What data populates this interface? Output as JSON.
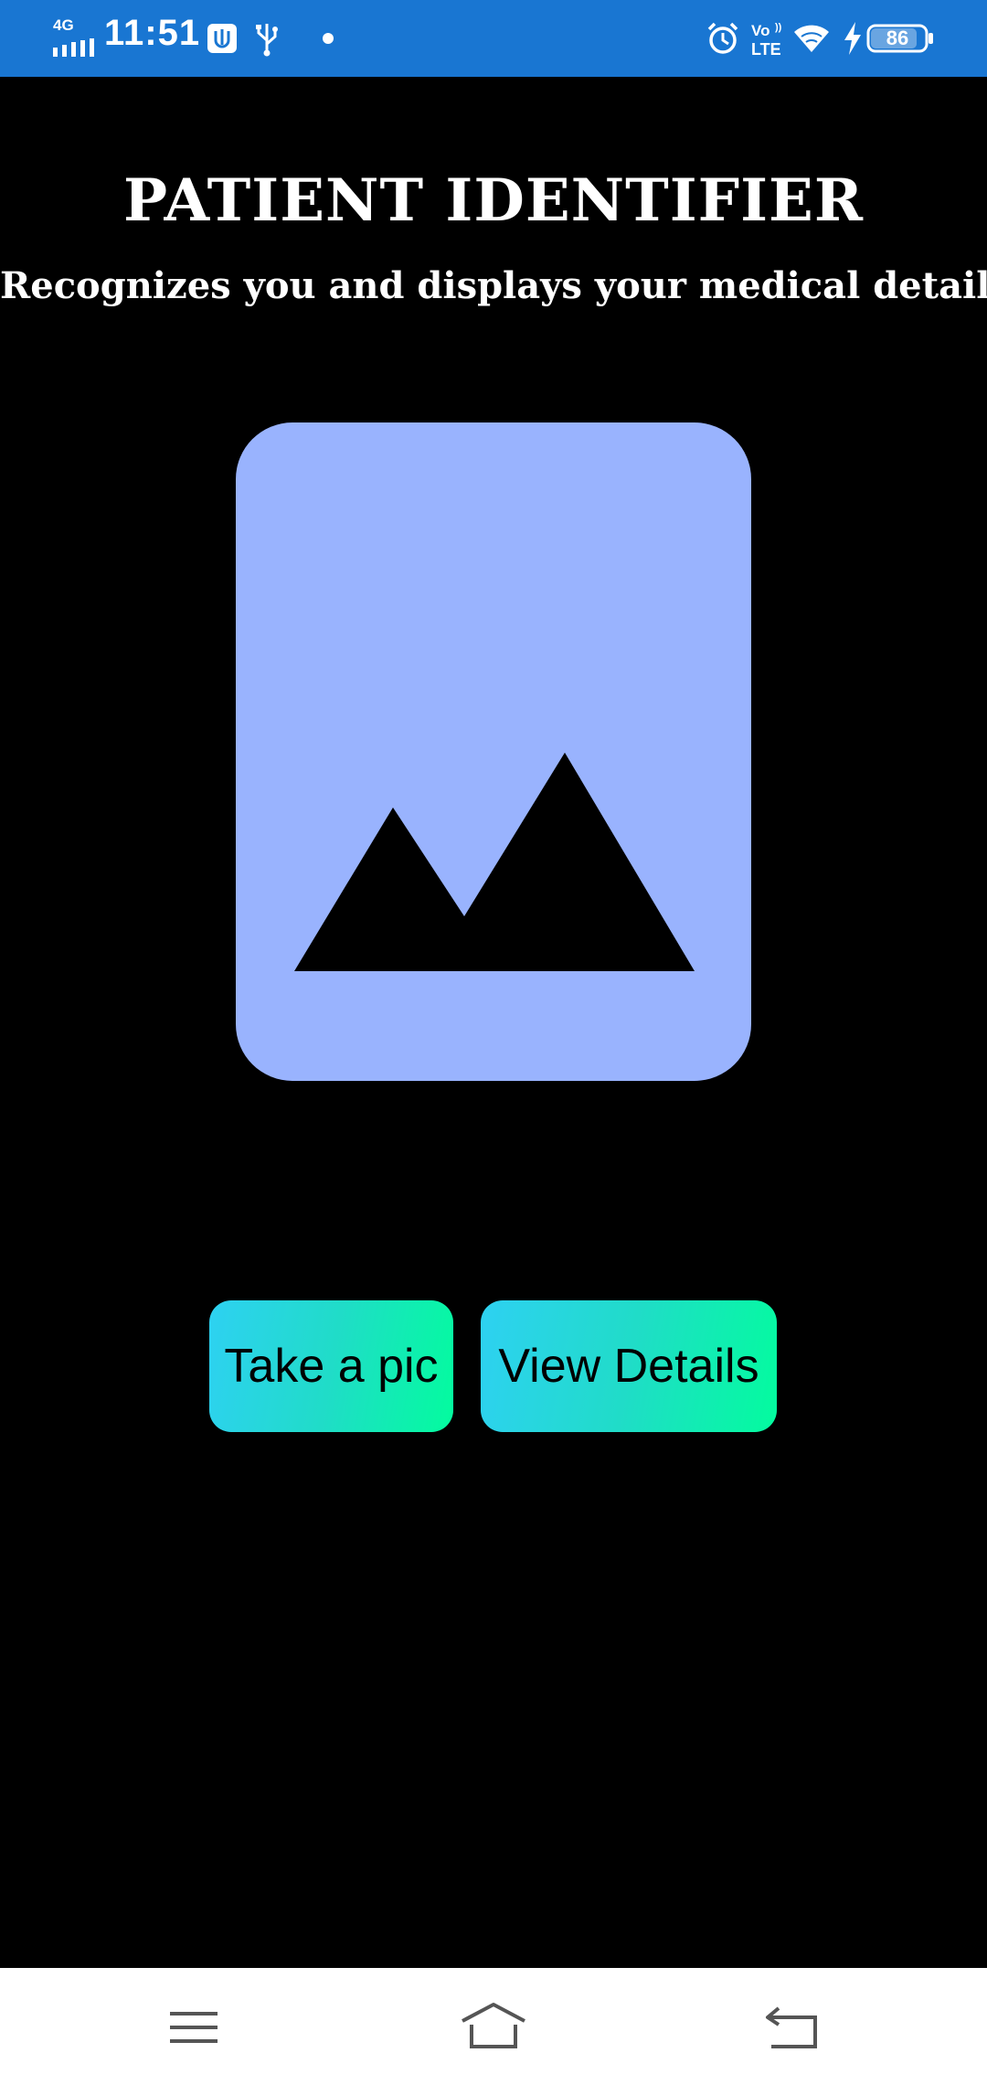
{
  "status_bar": {
    "network_type": "4G",
    "time": "11:51",
    "battery_level": "86",
    "icons": [
      "signal-icon",
      "usb-debug-icon",
      "usb-icon",
      "notification-dot-icon",
      "alarm-icon",
      "volte-icon",
      "wifi-icon",
      "charging-icon",
      "battery-icon"
    ]
  },
  "header": {
    "title": "PATIENT IDENTIFIER",
    "subtitle": "Recognizes you and displays your medical details"
  },
  "image_placeholder": {
    "icon": "image-placeholder-icon",
    "background_color": "#99b3fe"
  },
  "buttons": {
    "take_pic_label": "Take a pic",
    "view_details_label": "View Details",
    "gradient_start": "#2ed1f2",
    "gradient_end": "#03fc9e"
  },
  "nav_bar": {
    "icons": [
      "menu-icon",
      "home-icon",
      "back-icon"
    ]
  },
  "colors": {
    "status_bar": "#1976d2",
    "background": "#000000",
    "nav_bar": "#ffffff"
  }
}
